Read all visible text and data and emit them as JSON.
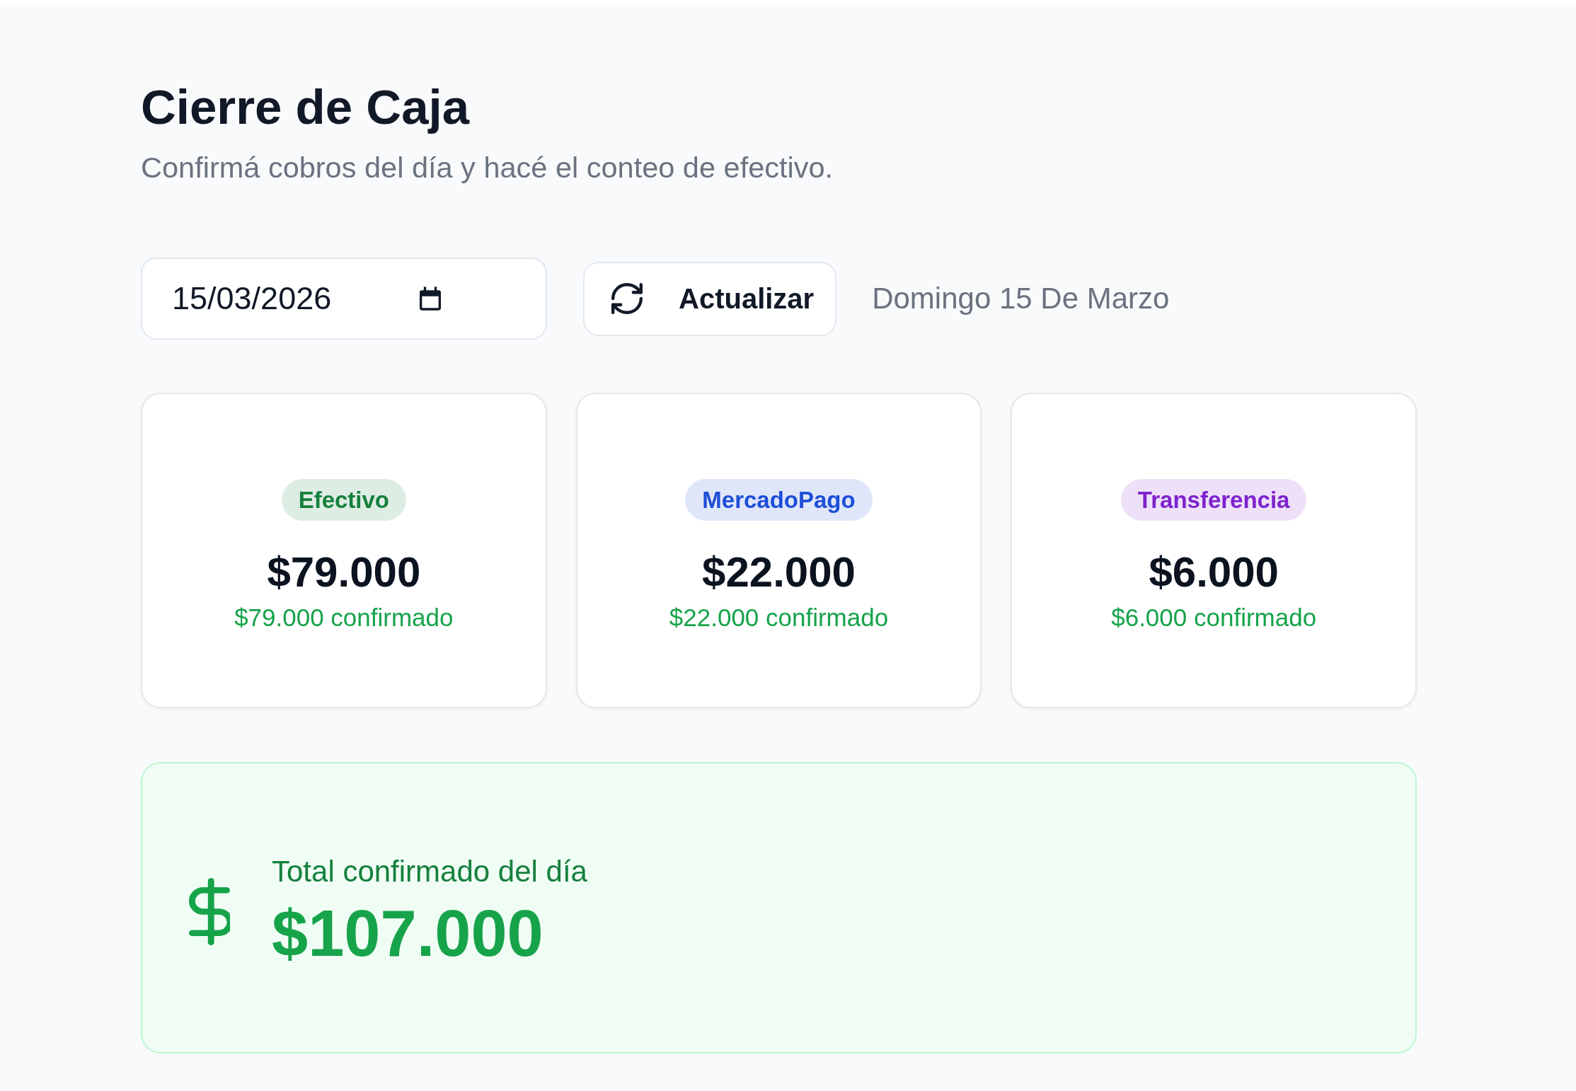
{
  "header": {
    "title": "Cierre de Caja",
    "subtitle": "Confirmá cobros del día y hacé el conteo de efectivo."
  },
  "toolbar": {
    "date_field": {
      "value": "15/03/2026"
    },
    "refresh_button": {
      "label": "Actualizar"
    },
    "date_label": "Domingo 15 De Marzo"
  },
  "cards": [
    {
      "method": "Efectivo",
      "color": "#15803d",
      "amount": "$79.000",
      "confirmed": "$79.000 confirmado"
    },
    {
      "method": "MercadoPago",
      "color": "#1d4ed8",
      "amount": "$22.000",
      "confirmed": "$22.000 confirmado"
    },
    {
      "method": "Transferencia",
      "color": "#7e22ce",
      "amount": "$6.000",
      "confirmed": "$6.000 confirmado"
    }
  ],
  "total": {
    "label": "Total confirmado del día",
    "amount": "$107.000"
  }
}
